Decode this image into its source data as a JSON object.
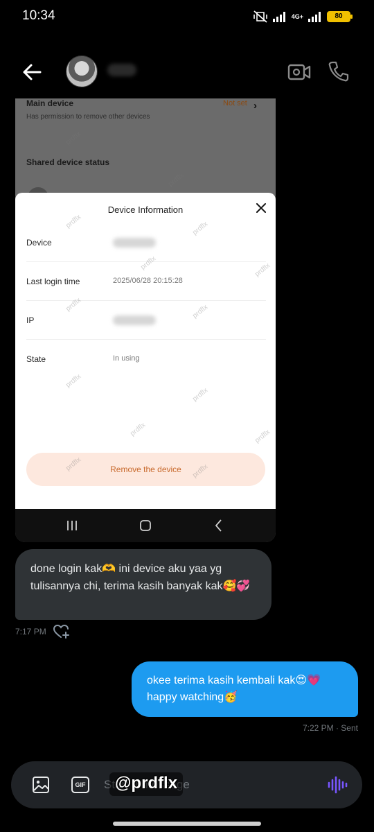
{
  "status_bar": {
    "time": "10:34",
    "network": "4G+",
    "battery": "80"
  },
  "chat_header": {
    "contact_name": "",
    "avatar_icon": "profile-avatar"
  },
  "embedded_screenshot": {
    "main_device_label": "Main device",
    "main_device_sub": "Has permission to remove other devices",
    "main_device_value": "Not set",
    "shared_status_label": "Shared device status",
    "dialog": {
      "title": "Device Information",
      "rows": [
        {
          "label": "Device",
          "value": ""
        },
        {
          "label": "Last login time",
          "value": "2025/06/28 20:15:28"
        },
        {
          "label": "IP",
          "value": ""
        },
        {
          "label": "State",
          "value": "In using"
        }
      ],
      "remove_button": "Remove the device"
    },
    "watermark": "prdflx"
  },
  "messages": [
    {
      "direction": "in",
      "text": "done login kak🫶 ini device aku yaa yg tulisannya chi, terima kasih banyak kak🥰💞",
      "time": "7:17 PM"
    },
    {
      "direction": "out",
      "text": "okee terima kasih kembali kak😍💗 happy watching🥳",
      "meta": "7:22 PM · Sent"
    }
  ],
  "composer": {
    "placeholder": "Start a message",
    "gif_label": "GIF"
  },
  "overlay_tag": "@prdflx",
  "colors": {
    "background": "#000000",
    "incoming_bubble": "#2f3336",
    "outgoing_bubble": "#1d9bf0",
    "accent_voice": "#7856ff",
    "remove_button_bg": "#fde8de",
    "remove_button_text": "#c8692c"
  }
}
